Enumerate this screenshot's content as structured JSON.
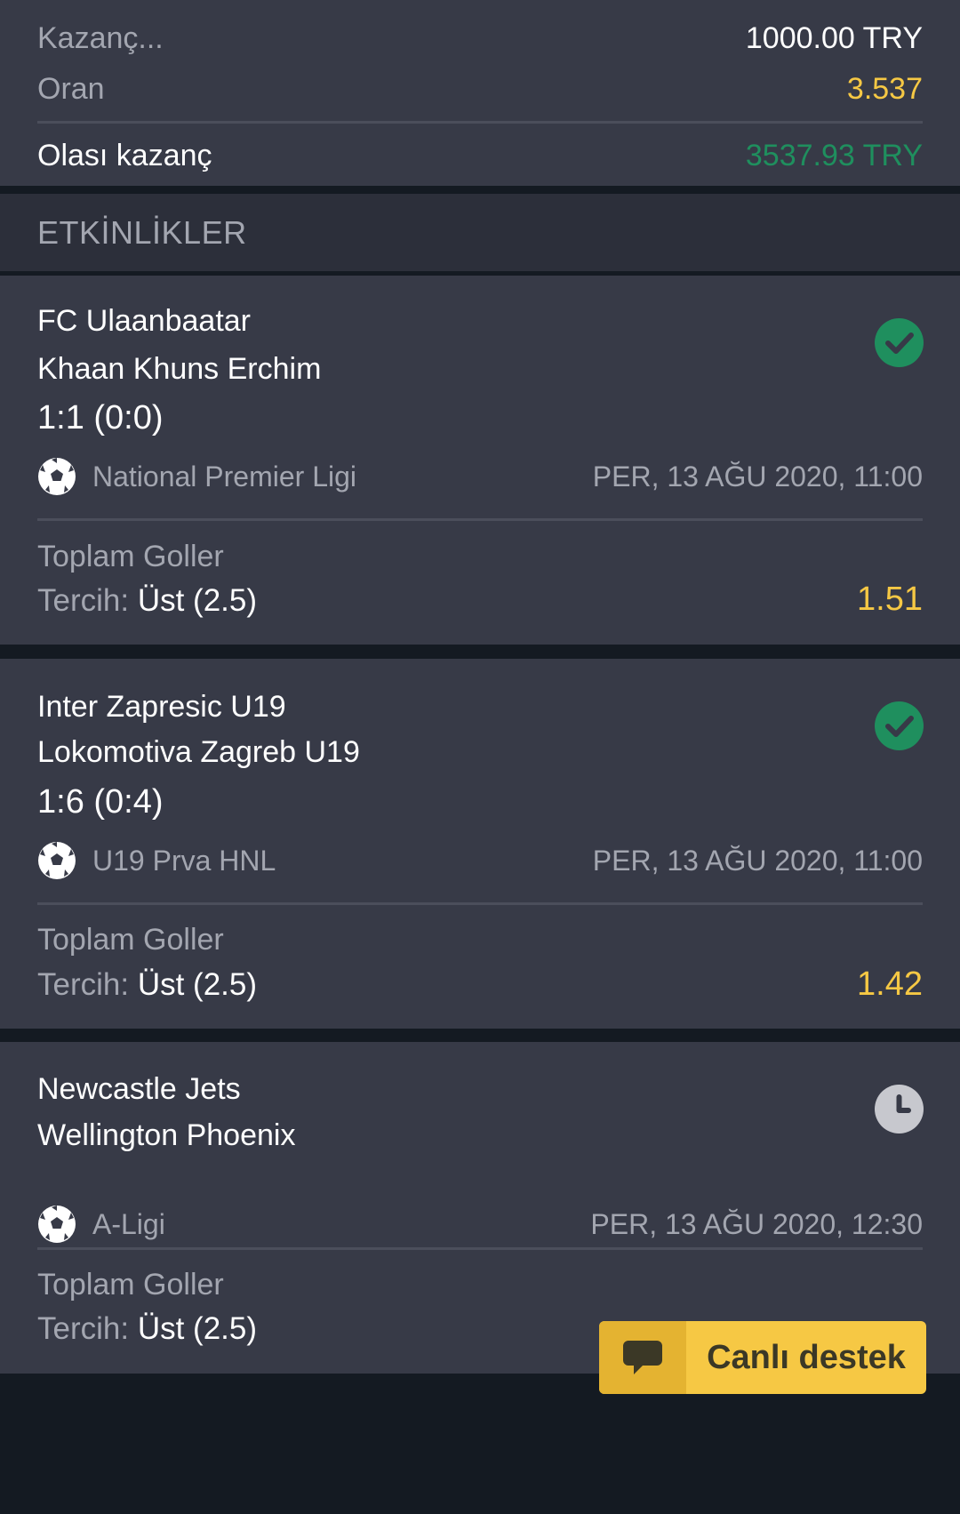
{
  "colors": {
    "background": "#141a22",
    "card": "#373a47",
    "section_header": "#2c2f3a",
    "odds_yellow": "#f6c844",
    "win_green": "#1f8f5e",
    "muted_text": "#a3a6b0",
    "support_button": "#f6c844"
  },
  "summary": {
    "stake_label": "Kazanç...",
    "stake_value": "1000.00 TRY",
    "odds_label": "Oran",
    "odds_value": "3.537",
    "potential_label": "Olası kazanç",
    "potential_value": "3537.93 TRY"
  },
  "section": {
    "title": "ETKİNLİKLER"
  },
  "events": [
    {
      "home": "FC Ulaanbaatar",
      "away": "Khaan Khuns Erchim",
      "score": "1:1 (0:0)",
      "status_icon": "check-circle-icon",
      "sport_icon": "soccer-ball-icon",
      "league": "National Premier Ligi",
      "date": "PER, 13 AĞU 2020, 11:00",
      "market": "Toplam Goller",
      "pick_label": "Tercih:",
      "pick_value": "Üst (2.5)",
      "odd": "1.51"
    },
    {
      "home": "Inter Zapresic U19",
      "away": "Lokomotiva Zagreb U19",
      "score": "1:6 (0:4)",
      "status_icon": "check-circle-icon",
      "sport_icon": "soccer-ball-icon",
      "league": "U19 Prva HNL",
      "date": "PER, 13 AĞU 2020, 11:00",
      "market": "Toplam Goller",
      "pick_label": "Tercih:",
      "pick_value": "Üst (2.5)",
      "odd": "1.42"
    },
    {
      "home": "Newcastle Jets",
      "away": "Wellington Phoenix",
      "status_icon": "clock-icon",
      "sport_icon": "soccer-ball-icon",
      "league": "A-Ligi",
      "date": "PER, 13 AĞU 2020, 12:30",
      "market": "Toplam Goller",
      "pick_label": "Tercih:",
      "pick_value": "Üst (2.5)"
    }
  ],
  "support": {
    "icon": "chat-bubble-icon",
    "label": "Canlı destek"
  }
}
